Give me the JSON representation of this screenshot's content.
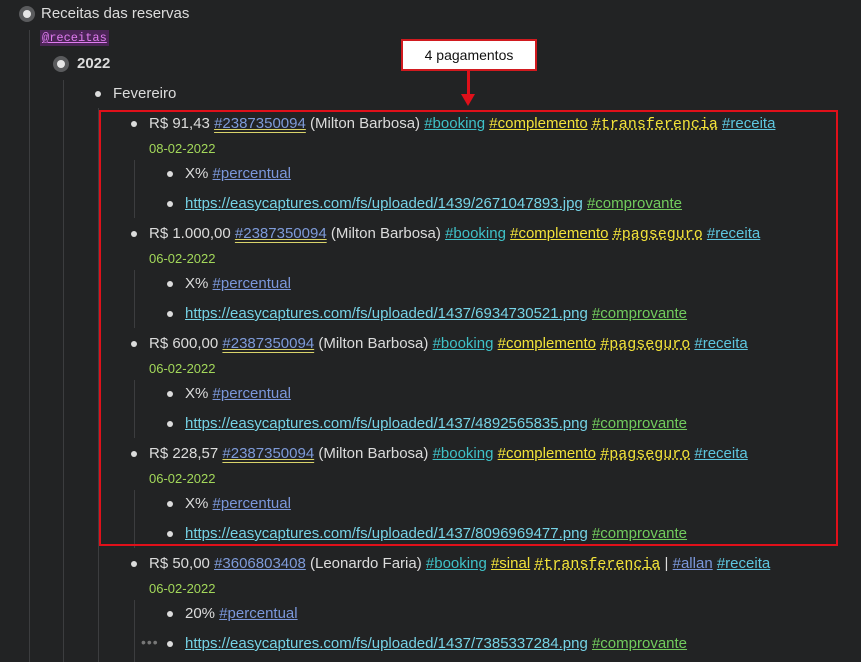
{
  "root": {
    "label": "Receitas das reservas",
    "mention": "@receitas"
  },
  "year": "2022",
  "month": "Fevereiro",
  "callout": "4 pagamentos",
  "payments": [
    {
      "amount": "R$ 91,43",
      "ref": "#2387350094",
      "person": "(Milton Barbosa)",
      "tags": [
        "#booking",
        "#complemento",
        "#transferencia",
        "#receita"
      ],
      "date": "08-02-2022",
      "note": "X%",
      "note_tag": "#percentual",
      "url": "https://easycaptures.com/fs/uploaded/1439/2671047893.jpg",
      "url_tag": "#comprovante"
    },
    {
      "amount": "R$ 1.000,00",
      "ref": "#2387350094",
      "person": "(Milton Barbosa)",
      "tags": [
        "#booking",
        "#complemento",
        "#pagseguro",
        "#receita"
      ],
      "date": "06-02-2022",
      "note": "X%",
      "note_tag": "#percentual",
      "url": "https://easycaptures.com/fs/uploaded/1437/6934730521.png",
      "url_tag": "#comprovante"
    },
    {
      "amount": "R$ 600,00",
      "ref": "#2387350094",
      "person": "(Milton Barbosa)",
      "tags": [
        "#booking",
        "#complemento",
        "#pagseguro",
        "#receita"
      ],
      "date": "06-02-2022",
      "note": "X%",
      "note_tag": "#percentual",
      "url": "https://easycaptures.com/fs/uploaded/1437/4892565835.png",
      "url_tag": "#comprovante"
    },
    {
      "amount": "R$ 228,57",
      "ref": "#2387350094",
      "person": "(Milton Barbosa)",
      "tags": [
        "#booking",
        "#complemento",
        "#pagseguro",
        "#receita"
      ],
      "date": "06-02-2022",
      "note": "X%",
      "note_tag": "#percentual",
      "url": "https://easycaptures.com/fs/uploaded/1437/8096969477.png",
      "url_tag": "#comprovante"
    },
    {
      "amount": "R$ 50,00",
      "ref": "#3606803408",
      "person": "(Leonardo Faria)",
      "tags": [
        "#booking",
        "#sinal",
        "#transferencia"
      ],
      "sep": "|",
      "extra_tags": [
        "#allan",
        "#receita"
      ],
      "date": "06-02-2022",
      "note": "20%",
      "note_tag": "#percentual",
      "url": "https://easycaptures.com/fs/uploaded/1437/7385337284.png",
      "url_tag": "#comprovante"
    }
  ],
  "colors": {
    "highlight": "#e0101a",
    "date": "#a3d85a",
    "background": "#222324"
  }
}
